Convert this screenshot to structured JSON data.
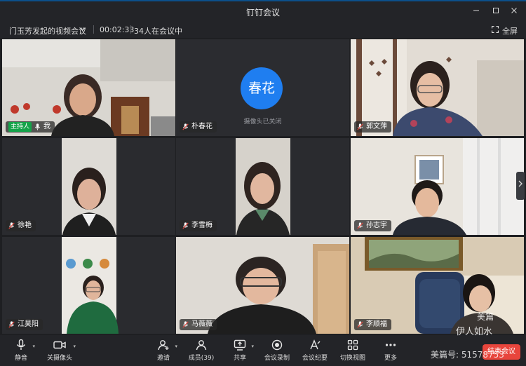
{
  "window": {
    "title": "钉钉会议"
  },
  "info": {
    "meeting_name": "门玉芳发起的视频会议",
    "duration": "00:02:33",
    "participant_count": "34人在会议中",
    "fullscreen_label": "全屏"
  },
  "tiles": [
    {
      "name": "我",
      "host_label": "主持人",
      "camera": "on"
    },
    {
      "name": "朴春花",
      "camera": "off",
      "avatar_text": "春花",
      "camera_off_text": "摄像头已关闭"
    },
    {
      "name": "郭文萍",
      "camera": "on"
    },
    {
      "name": "徐艳",
      "camera": "on"
    },
    {
      "name": "李雪梅",
      "camera": "on"
    },
    {
      "name": "孙志宇",
      "camera": "on"
    },
    {
      "name": "江昊阳",
      "camera": "on"
    },
    {
      "name": "马薇薇",
      "camera": "on"
    },
    {
      "name": "李顺福",
      "camera": "on"
    }
  ],
  "toolbar": {
    "mute": "静音",
    "camera": "关摄像头",
    "invite": "邀请",
    "members": "成员(39)",
    "share": "共享",
    "record": "会议录制",
    "minutes": "会议纪要",
    "view": "切换视图",
    "more": "更多",
    "end": "结束会议"
  },
  "watermark": {
    "logo": "美篇",
    "author": "伊人如水",
    "id": "美篇号: 51578753"
  },
  "colors": {
    "accent": "#1f7ef0",
    "host_badge": "#14a34a",
    "end_button": "#e8453c"
  }
}
